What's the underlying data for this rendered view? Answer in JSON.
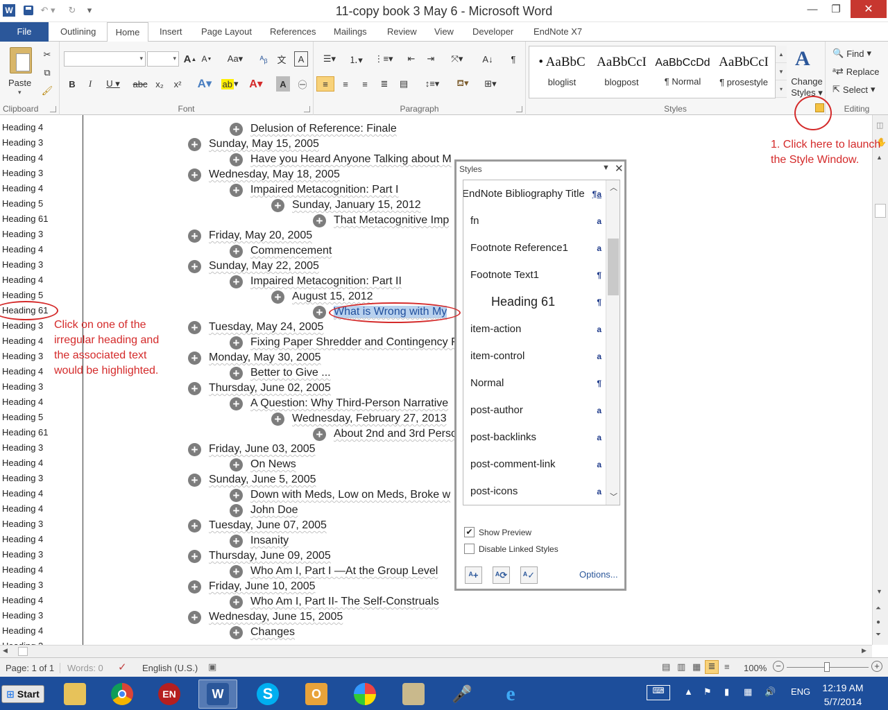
{
  "window": {
    "title": "11-copy book 3 May 6 - Microsoft Word",
    "logo": "W"
  },
  "ribbon_tabs": [
    "File",
    "Outlining",
    "Home",
    "Insert",
    "Page Layout",
    "References",
    "Mailings",
    "Review",
    "View",
    "Developer",
    "EndNote X7"
  ],
  "ribbon": {
    "clipboard": {
      "paste_label": "Paste",
      "group_label": "Clipboard"
    },
    "font": {
      "group_label": "Font",
      "font_name": "",
      "font_size": ""
    },
    "paragraph": {
      "group_label": "Paragraph"
    },
    "styles": {
      "group_label": "Styles",
      "items": [
        {
          "sample": "AaBbC",
          "name": "bloglist",
          "bullet": "•"
        },
        {
          "sample": "AaBbCcI",
          "name": "blogpost",
          "bullet": ""
        },
        {
          "sample": "AaBbCcDd",
          "name": "¶ Normal",
          "bullet": ""
        },
        {
          "sample": "AaBbCcI",
          "name": "¶ prosestyle",
          "bullet": ""
        }
      ],
      "change_styles_label": "Change Styles"
    },
    "editing": {
      "group_label": "Editing",
      "find_label": "Find",
      "replace_label": "Replace",
      "select_label": "Select"
    }
  },
  "nav_headings": [
    "Heading 4",
    "Heading 3",
    "Heading 4",
    "Heading 3",
    "Heading 4",
    "Heading 5",
    "Heading 61",
    "Heading 3",
    "Heading 4",
    "Heading 3",
    "Heading 4",
    "Heading 5",
    "Heading 61",
    "Heading 3",
    "Heading 4",
    "Heading 3",
    "Heading 4",
    "Heading 3",
    "Heading 4",
    "Heading 5",
    "Heading 61",
    "Heading 3",
    "Heading 4",
    "Heading 3",
    "Heading 4",
    "Heading 4",
    "Heading 3",
    "Heading 4",
    "Heading 3",
    "Heading 4",
    "Heading 3",
    "Heading 4",
    "Heading 3",
    "Heading 4",
    "Heading 3",
    "Heading 4"
  ],
  "document_lines": [
    {
      "text": "Delusion of Reference: Finale",
      "level": 2
    },
    {
      "text": "Sunday, May 15, 2005",
      "level": 1
    },
    {
      "text": "Have you Heard Anyone Talking about M",
      "level": 2
    },
    {
      "text": "Wednesday, May 18, 2005",
      "level": 1
    },
    {
      "text": "Impaired Metacognition: Part I",
      "level": 2
    },
    {
      "text": "Sunday, January 15, 2012",
      "level": 3
    },
    {
      "text": "That Metacognitive Imp",
      "level": 4
    },
    {
      "text": "Friday, May 20, 2005",
      "level": 1
    },
    {
      "text": "Commencement",
      "level": 2
    },
    {
      "text": "Sunday, May 22, 2005",
      "level": 1
    },
    {
      "text": "Impaired Metacognition: Part II",
      "level": 2
    },
    {
      "text": "August 15, 2012",
      "level": 3
    },
    {
      "text": "What is Wrong with My",
      "level": 4,
      "selected": true
    },
    {
      "text": "Tuesday, May 24, 2005",
      "level": 1
    },
    {
      "text": "Fixing Paper Shredder and Contingency F",
      "level": 2
    },
    {
      "text": "Monday, May 30, 2005",
      "level": 1
    },
    {
      "text": "Better to Give ...",
      "level": 2
    },
    {
      "text": "Thursday, June 02, 2005",
      "level": 1
    },
    {
      "text": "A Question: Why Third-Person Narrative",
      "level": 2
    },
    {
      "text": "Wednesday, February 27, 2013",
      "level": 3
    },
    {
      "text": "About 2nd and 3rd Perso",
      "level": 4
    },
    {
      "text": "Friday, June 03, 2005",
      "level": 1
    },
    {
      "text": "On News",
      "level": 2
    },
    {
      "text": "Sunday, June 5, 2005",
      "level": 1
    },
    {
      "text": "Down with Meds, Low on Meds, Broke w",
      "level": 2
    },
    {
      "text": "John Doe",
      "level": 2
    },
    {
      "text": "Tuesday, June 07, 2005",
      "level": 1
    },
    {
      "text": "Insanity",
      "level": 2
    },
    {
      "text": "Thursday, June 09, 2005",
      "level": 1
    },
    {
      "text": "Who Am I, Part I —At the Group Level",
      "level": 2
    },
    {
      "text": "Friday, June 10, 2005",
      "level": 1
    },
    {
      "text": "Who Am I, Part II- The Self-Construals",
      "level": 2
    },
    {
      "text": "Wednesday, June 15, 2005",
      "level": 1
    },
    {
      "text": "Changes",
      "level": 2
    }
  ],
  "styles_pane": {
    "title": "Styles",
    "items": [
      {
        "name": "EndNote Bibliography Title",
        "mark": "¶a",
        "indent": false
      },
      {
        "name": "fn",
        "mark": "a",
        "indent": false
      },
      {
        "name": "Footnote Reference1",
        "mark": "a",
        "indent": false
      },
      {
        "name": "Footnote Text1",
        "mark": "¶",
        "indent": false
      },
      {
        "name": "Heading 61",
        "mark": "¶",
        "indent": true
      },
      {
        "name": "item-action",
        "mark": "a",
        "indent": false
      },
      {
        "name": "item-control",
        "mark": "a",
        "indent": false
      },
      {
        "name": "Normal",
        "mark": "¶",
        "indent": false
      },
      {
        "name": "post-author",
        "mark": "a",
        "indent": false
      },
      {
        "name": "post-backlinks",
        "mark": "a",
        "indent": false
      },
      {
        "name": "post-comment-link",
        "mark": "a",
        "indent": false
      },
      {
        "name": "post-icons",
        "mark": "a",
        "indent": false
      }
    ],
    "show_preview": {
      "label": "Show Preview",
      "checked": true
    },
    "disable_linked": {
      "label": "Disable Linked Styles",
      "checked": false
    },
    "options_label": "Options..."
  },
  "annotations": {
    "launch_note": "1. Click here to launch the Style Window.",
    "heading_note": "Click on one of the irregular heading and the associated text would be highlighted."
  },
  "statusbar": {
    "page": "Page: 1 of 1",
    "words": "Words: 0",
    "language": "English (U.S.)",
    "zoom": "100%"
  },
  "taskbar": {
    "start_label": "Start",
    "lang": "ENG",
    "time": "12:19 AM",
    "date": "5/7/2014"
  },
  "colors": {
    "accent": "#2b579a",
    "annotation": "#d42a2a",
    "selection": "#b8d1ee",
    "taskbar": "#1d4e9b"
  }
}
